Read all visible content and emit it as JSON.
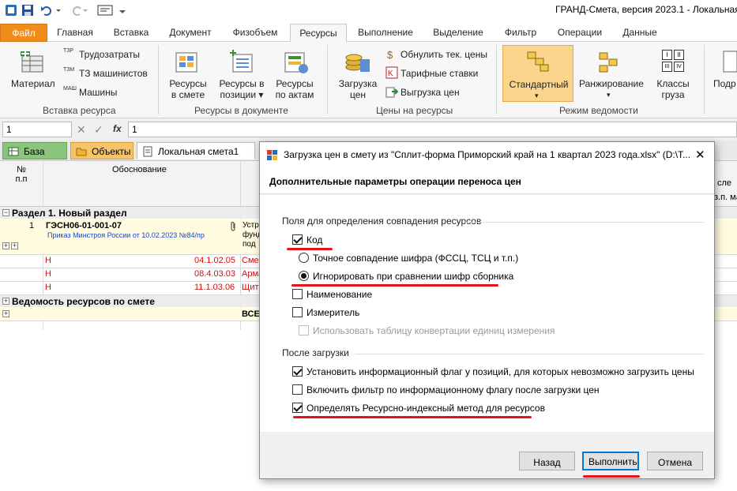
{
  "app": {
    "title": "ГРАНД-Смета, версия 2023.1 - Локальная"
  },
  "ribbon_tabs": [
    {
      "label": "Файл"
    },
    {
      "label": "Главная"
    },
    {
      "label": "Вставка"
    },
    {
      "label": "Документ"
    },
    {
      "label": "Физобъем"
    },
    {
      "label": "Ресурсы"
    },
    {
      "label": "Выполнение"
    },
    {
      "label": "Выделение"
    },
    {
      "label": "Фильтр"
    },
    {
      "label": "Операции"
    },
    {
      "label": "Данные"
    }
  ],
  "ribbon": {
    "material": "Материал",
    "trudozatraty": "Трудозатраты",
    "tz_mashinistov": "ТЗ машинистов",
    "mashiny": "Машины",
    "group_insert": "Вставка ресурса",
    "res_in_smeta_1": "Ресурсы",
    "res_in_smeta_2": "в смете",
    "res_in_pos_1": "Ресурсы в",
    "res_in_pos_2": "позиции ▾",
    "res_by_acts_1": "Ресурсы",
    "res_by_acts_2": "по актам",
    "group_doc": "Ресурсы в документе",
    "load_prices_1": "Загрузка",
    "load_prices_2": "цен",
    "reset_prices": "Обнулить тек. цены",
    "tariff_rates": "Тарифные ставки",
    "export_prices": "Выгрузка цен",
    "group_prices": "Цены на ресурсы",
    "standard": "Стандартный",
    "ranking": "Ранжирование",
    "cargo_1": "Классы",
    "cargo_2": "груза",
    "group_mode": "Режим ведомости",
    "podr": "Подр",
    "icon_tzr": "ТЗР",
    "icon_tzm": "ТЗМ",
    "icon_mash": "МАШ",
    "icon_cargo_1": "I",
    "icon_cargo_2": "II",
    "icon_cargo_3": "III",
    "icon_cargo_4": "IV"
  },
  "formula_bar": {
    "cell_ref": "1",
    "value": "1",
    "fx": "fx"
  },
  "doc_tabs": [
    {
      "label": "База"
    },
    {
      "label": "Объекты"
    },
    {
      "label": "Локальная смета1"
    }
  ],
  "grid": {
    "col_num_1": "№",
    "col_num_2": "п.п",
    "col_basis": "Обоснование",
    "col_right_1": "сле",
    "col_right_2": "з.п. ма",
    "section1": "Раздел 1. Новый раздел",
    "row1_num": "1",
    "row1_code": "ГЭСН06-01-001-07",
    "row1_order": "Приказ Минстроя России от 10.02.2023 №84/пр",
    "row1_name_1": "Устр",
    "row1_name_2": "фунд",
    "row1_name_3": "под",
    "sub_rows": [
      {
        "flag": "Н",
        "code": "04.1.02.05",
        "name": "Смес"
      },
      {
        "flag": "Н",
        "code": "08.4.03.03",
        "name": "Арма"
      },
      {
        "flag": "Н",
        "code": "11.1.03.06",
        "name": "Щит"
      }
    ],
    "section2": "Ведомость ресурсов по смете",
    "total": "ВСЕ"
  },
  "dialog": {
    "title": "Загрузка цен в смету из \"Сплит-форма Приморский край на 1 квартал 2023 года.xlsx\" (D:\\Т...",
    "header": "Дополнительные параметры операции переноса цен",
    "section1": "Поля для определения совпадения ресурсов",
    "opt_code": "Код",
    "opt_exact": "Точное совпадение шифра (ФССЦ, ТСЦ и т.п.)",
    "opt_ignore": "Игнорировать при сравнении шифр сборника",
    "opt_name": "Наименование",
    "opt_unit": "Измеритель",
    "opt_convert": "Использовать таблицу конвертации единиц измерения",
    "section2": "После загрузки",
    "opt_flag": "Установить информационный флаг у позиций, для которых невозможно загрузить цены",
    "opt_filter": "Включить фильтр по информационному флагу после загрузки цен",
    "opt_rim": "Определять Ресурсно-индексный метод для ресурсов",
    "btn_back": "Назад",
    "btn_run": "Выполнить",
    "btn_cancel": "Отмена",
    "close": "✕"
  },
  "colors": {
    "accent_orange": "#f08c1a",
    "selected_blue": "#0078d7",
    "highlight_red": "#e3141c",
    "row_yellow": "#fffce0"
  }
}
